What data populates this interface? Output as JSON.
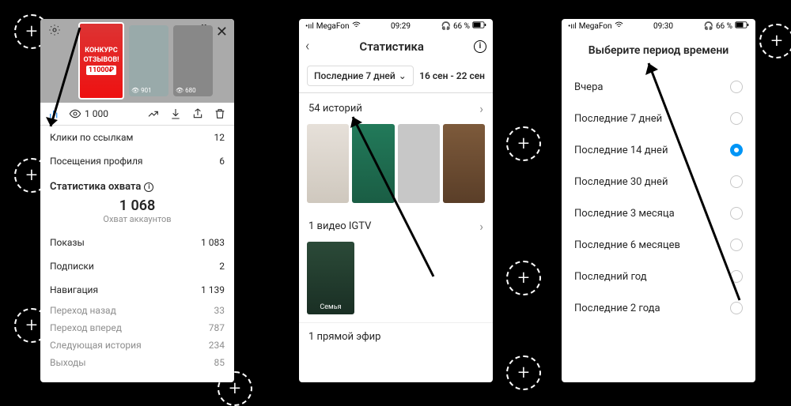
{
  "phone1": {
    "story_previews": {
      "focus_line1": "КОНКУРС",
      "focus_line2": "ОТЗЫВОВ!",
      "focus_prize": "11000₽",
      "views_t2": "901",
      "views_t3": "680"
    },
    "toolbar_views": "1 000",
    "link_clicks_label": "Клики по ссылкам",
    "link_clicks_value": "12",
    "profile_visits_label": "Посещения профиля",
    "profile_visits_value": "6",
    "reach_title": "Статистика охвата",
    "reach_value": "1 068",
    "reach_sub": "Охват аккаунтов",
    "impressions_label": "Показы",
    "impressions_value": "1 083",
    "follows_label": "Подписки",
    "follows_value": "2",
    "navigation_label": "Навигация",
    "navigation_value": "1 139",
    "nav_back_label": "Переход назад",
    "nav_back_value": "33",
    "nav_fwd_label": "Переход вперед",
    "nav_fwd_value": "787",
    "nav_next_label": "Следующая история",
    "nav_next_value": "234",
    "nav_exit_label": "Выходы",
    "nav_exit_value": "85"
  },
  "phone2": {
    "status_carrier": "MegaFon",
    "status_time": "09:29",
    "status_battery": "66 %",
    "title": "Статистика",
    "filter_pill": "Последние 7 дней",
    "filter_range": "16 сен - 22 сен",
    "stories_count": "54 историй",
    "igtv_count": "1 видео IGTV",
    "igtv_tile_label": "Семья",
    "live_count": "1 прямой эфир"
  },
  "phone3": {
    "status_carrier": "MegaFon",
    "status_time": "09:30",
    "status_battery": "66 %",
    "title": "Выберите период времени",
    "options": {
      "o0": "Вчера",
      "o1": "Последние 7 дней",
      "o2": "Последние 14 дней",
      "o3": "Последние 30 дней",
      "o4": "Последние 3 месяца",
      "o5": "Последние 6 месяцев",
      "o6": "Последний год",
      "o7": "Последние 2 года"
    },
    "selected_index": 2
  }
}
